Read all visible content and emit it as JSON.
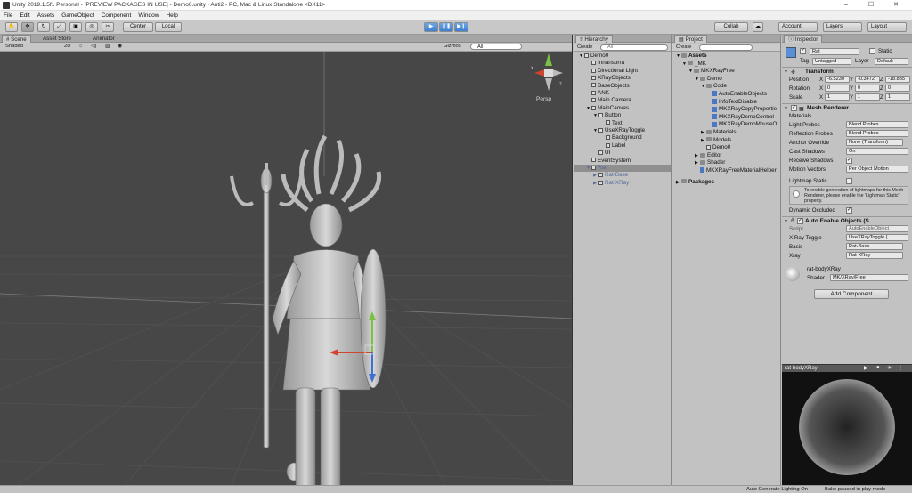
{
  "window": {
    "title": "Unity 2019.1.5f1 Personal - [PREVIEW PACKAGES IN USE] - Demo0.unity - Anti2 - PC, Mac & Linux Standalone <DX11>",
    "controls": [
      "–",
      "☐",
      "✕"
    ]
  },
  "menu": [
    "File",
    "Edit",
    "Assets",
    "GameObject",
    "Component",
    "Window",
    "Help"
  ],
  "toolbar": {
    "pivot": "Center",
    "space": "Local",
    "collab": "Collab",
    "account": "Account",
    "layers": "Layers",
    "layout": "Layout"
  },
  "scene": {
    "tabs": [
      "Scene",
      "Asset Store",
      "Animator"
    ],
    "shading": "Shaded",
    "mode": "2D",
    "gizmos": "Gizmos",
    "search": "All",
    "persp": "Persp",
    "axes": {
      "y": "y",
      "x": "x",
      "z": "z"
    }
  },
  "hierarchy": {
    "tab": "Hierarchy",
    "create": "Create",
    "search": "All",
    "items": [
      {
        "label": "Demo0",
        "depth": 0
      },
      {
        "label": "Innansorra",
        "depth": 1
      },
      {
        "label": "Directional Light",
        "depth": 1
      },
      {
        "label": "XRayObjects",
        "depth": 1
      },
      {
        "label": "BaseObjects",
        "depth": 1
      },
      {
        "label": "ANK",
        "depth": 1
      },
      {
        "label": "Main Camera",
        "depth": 1
      },
      {
        "label": "MainCanvas",
        "depth": 1
      },
      {
        "label": "Button",
        "depth": 2
      },
      {
        "label": "Text",
        "depth": 3
      },
      {
        "label": "UseXRayToggle",
        "depth": 2
      },
      {
        "label": "Background",
        "depth": 3
      },
      {
        "label": "Label",
        "depth": 3
      },
      {
        "label": "UI",
        "depth": 2
      },
      {
        "label": "EventSystem",
        "depth": 1
      },
      {
        "label": "Rat",
        "depth": 1
      },
      {
        "label": "Rat-Base",
        "depth": 2
      },
      {
        "label": "Rat-XRay",
        "depth": 2
      }
    ]
  },
  "project": {
    "tab": "Project",
    "create": "Create",
    "items": [
      {
        "label": "Assets",
        "depth": 0,
        "kind": "folder"
      },
      {
        "label": "_MK",
        "depth": 1,
        "kind": "folder"
      },
      {
        "label": "MKXRayFree",
        "depth": 2,
        "kind": "folder"
      },
      {
        "label": "Demo",
        "depth": 3,
        "kind": "folder"
      },
      {
        "label": "Code",
        "depth": 4,
        "kind": "folder"
      },
      {
        "label": "AutoEnableObjects",
        "depth": 5,
        "kind": "script"
      },
      {
        "label": "InfoTextDisable",
        "depth": 5,
        "kind": "script"
      },
      {
        "label": "MKXRayCopyPropertie",
        "depth": 5,
        "kind": "script"
      },
      {
        "label": "MKXRayDemoControl",
        "depth": 5,
        "kind": "script"
      },
      {
        "label": "MKXRayDemoMouseO",
        "depth": 5,
        "kind": "script"
      },
      {
        "label": "Materials",
        "depth": 4,
        "kind": "folder"
      },
      {
        "label": "Models",
        "depth": 4,
        "kind": "folder"
      },
      {
        "label": "Demo0",
        "depth": 4,
        "kind": "scene"
      },
      {
        "label": "Editor",
        "depth": 3,
        "kind": "folder"
      },
      {
        "label": "Shader",
        "depth": 3,
        "kind": "folder"
      },
      {
        "label": "MKXRayFreeMaterialHelper",
        "depth": 3,
        "kind": "script"
      },
      {
        "label": "Packages",
        "depth": 0,
        "kind": "folder"
      }
    ]
  },
  "inspector": {
    "tab": "Inspector",
    "object_name": "Rat",
    "static": "Static",
    "tag_label": "Tag",
    "tag": "Untagged",
    "layer_label": "Layer",
    "layer": "Default",
    "transform": {
      "title": "Transform",
      "position_label": "Position",
      "rotation_label": "Rotation",
      "scale_label": "Scale",
      "position": [
        "-6.5230",
        "-0.3472",
        "-18.835"
      ],
      "rotation": [
        "0",
        "0",
        "0"
      ],
      "scale": [
        "1",
        "1",
        "1"
      ]
    },
    "mesh_renderer": {
      "title": "Mesh Renderer",
      "materials": "Materials",
      "light_probes_label": "Light Probes",
      "light_probes": "Blend Probes",
      "reflection_probes_label": "Reflection Probes",
      "reflection_probes": "Blend Probes",
      "anchor_override_label": "Anchor Override",
      "anchor_override": "None (Transform)",
      "cast_shadows_label": "Cast Shadows",
      "cast_shadows": "On",
      "receive_shadows_label": "Receive Shadows",
      "motion_vectors_label": "Motion Vectors",
      "motion_vectors": "Per Object Motion",
      "lightmap_static_label": "Lightmap Static",
      "info": "To enable generation of lightmaps for this Mesh Renderer, please enable the 'Lightmap Static' property.",
      "dynamic_occluded_label": "Dynamic Occluded"
    },
    "auto_enable": {
      "title": "Auto Enable Objects (S",
      "script_label": "Script",
      "script": "AutoEnableObject",
      "xray_toggle_label": "X Ray Toggle",
      "xray_toggle": "UseXRayToggle (",
      "basic_label": "Basic",
      "basic": "Rat-Base",
      "xray_label": "Xray",
      "xray": "Rat-XRay"
    },
    "material": {
      "name": "rat-bodyXRay",
      "shader_label": "Shader",
      "shader": "MK/XRay/Free"
    },
    "add_component": "Add Component",
    "preview_title": "rat-bodyXRay"
  },
  "status": {
    "lighting": "Auto Generate Lighting On",
    "bake": "Bake paused in play mode"
  },
  "colors": {
    "scene_bg": "#474747",
    "panel_bg": "#c2c2c2",
    "selection": "#8f8f8f",
    "play_blue": "#3d7fd0"
  }
}
